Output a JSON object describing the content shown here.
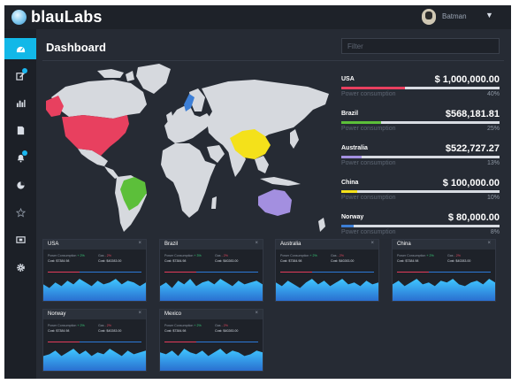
{
  "header": {
    "logo_text": "blauLabs",
    "user_name": "Batman"
  },
  "page": {
    "title": "Dashboard",
    "filter_placeholder": "Filter"
  },
  "sidebar": {
    "items": [
      {
        "icon": "dashboard-icon",
        "active": true,
        "badge": false
      },
      {
        "icon": "edit-icon",
        "active": false,
        "badge": true
      },
      {
        "icon": "bar-chart-icon",
        "active": false,
        "badge": false
      },
      {
        "icon": "document-icon",
        "active": false,
        "badge": false
      },
      {
        "icon": "bell-icon",
        "active": false,
        "badge": true
      },
      {
        "icon": "pie-chart-icon",
        "active": false,
        "badge": false
      },
      {
        "icon": "star-icon",
        "active": false,
        "badge": false
      },
      {
        "icon": "screen-icon",
        "active": false,
        "badge": false
      },
      {
        "icon": "gear-icon",
        "active": false,
        "badge": false
      }
    ]
  },
  "country_stats": [
    {
      "name": "USA",
      "value": "$ 1,000,000.00",
      "sub": "Power consumption",
      "pct": "40%",
      "color": "#e8405f",
      "fraction": 0.4
    },
    {
      "name": "Brazil",
      "value": "$568,181.81",
      "sub": "Power consumption",
      "pct": "25%",
      "color": "#5cbf3a",
      "fraction": 0.25
    },
    {
      "name": "Australia",
      "value": "$522,727.27",
      "sub": "Power consumption",
      "pct": "13%",
      "color": "#a38fe0",
      "fraction": 0.13
    },
    {
      "name": "China",
      "value": "$ 100,000.00",
      "sub": "Power consumption",
      "pct": "10%",
      "color": "#f4e11a",
      "fraction": 0.1
    },
    {
      "name": "Norway",
      "value": "$ 80,000.00",
      "sub": "Power consumption",
      "pct": "8%",
      "color": "#3d7fd6",
      "fraction": 0.08
    }
  ],
  "map_colors": {
    "land": "#d6d9de",
    "usa": "#e8405f",
    "brazil": "#5cbf3a",
    "australia": "#a38fe0",
    "china": "#f4e11a",
    "norway": "#3d7fd6"
  },
  "cards": [
    {
      "title": "USA",
      "line1_label": "Power Consumption",
      "line1_delta": "+ 2%",
      "line1_delta_dir": "up",
      "line1_right": "Gas",
      "line1_right_delta": "- 2%",
      "line2_left": "Cost: $7384.98",
      "line2_right": "Cost: $40283.00",
      "spark": [
        9,
        7,
        10,
        8,
        11,
        9,
        12,
        10,
        8,
        11,
        9,
        10,
        12,
        9,
        11,
        10,
        8,
        10
      ]
    },
    {
      "title": "Brazil",
      "line1_label": "Power Consumption",
      "line1_delta": "+ 3%",
      "line1_delta_dir": "up",
      "line1_right": "Gas",
      "line1_right_delta": "- 2%",
      "line2_left": "Cost: $7384.98",
      "line2_right": "Cost: $40283.00",
      "spark": [
        8,
        10,
        7,
        11,
        9,
        12,
        8,
        10,
        11,
        9,
        12,
        10,
        8,
        11,
        9,
        10,
        11,
        9
      ]
    },
    {
      "title": "Australia",
      "line1_label": "Power Consumption",
      "line1_delta": "+ 2%",
      "line1_delta_dir": "up",
      "line1_right": "Gas",
      "line1_right_delta": "- 2%",
      "line2_left": "Cost: $7384.98",
      "line2_right": "Cost: $40283.00",
      "spark": [
        10,
        8,
        11,
        9,
        7,
        10,
        12,
        9,
        11,
        8,
        10,
        12,
        9,
        10,
        8,
        11,
        9,
        10
      ]
    },
    {
      "title": "China",
      "line1_label": "Power Consumption",
      "line1_delta": "+ 2%",
      "line1_delta_dir": "up",
      "line1_right": "Gas",
      "line1_right_delta": "- 2%",
      "line2_left": "Cost: $7384.98",
      "line2_right": "Cost: $40283.00",
      "spark": [
        9,
        11,
        8,
        10,
        12,
        9,
        10,
        8,
        11,
        10,
        12,
        9,
        8,
        10,
        11,
        9,
        12,
        10
      ]
    },
    {
      "title": "Norway",
      "line1_label": "Power Consumption",
      "line1_delta": "+ 2%",
      "line1_delta_dir": "up",
      "line1_right": "Gas",
      "line1_right_delta": "- 2%",
      "line2_left": "Cost: $7384.98",
      "line2_right": "Cost: $40283.00",
      "spark": [
        8,
        9,
        11,
        8,
        10,
        12,
        9,
        11,
        8,
        10,
        9,
        12,
        10,
        8,
        11,
        9,
        10,
        11
      ]
    },
    {
      "title": "Mexico",
      "line1_label": "Power Consumption",
      "line1_delta": "+ 2%",
      "line1_delta_dir": "up",
      "line1_right": "Gas",
      "line1_right_delta": "- 2%",
      "line2_left": "Cost: $7384.98",
      "line2_right": "Cost: $40283.00",
      "spark": [
        10,
        9,
        11,
        8,
        12,
        10,
        9,
        11,
        8,
        10,
        12,
        9,
        11,
        10,
        8,
        9,
        11,
        10
      ]
    }
  ]
}
